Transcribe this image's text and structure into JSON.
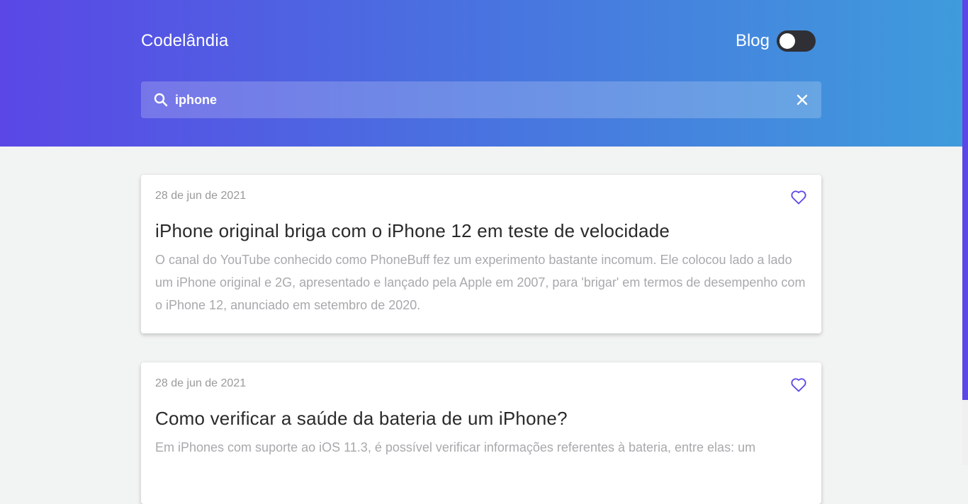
{
  "header": {
    "brand": "Codelândia",
    "blog_label": "Blog",
    "toggle_state": "off"
  },
  "search": {
    "value": "iphone",
    "icon": "search-icon",
    "clear_icon": "close-icon"
  },
  "posts": [
    {
      "date": "28 de jun de 2021",
      "title": "iPhone original briga com o iPhone 12 em teste de velocidade",
      "excerpt": "O canal do YouTube conhecido como PhoneBuff fez um experimento bastante incomum. Ele colocou lado a lado um iPhone original e 2G, apresentado e lançado pela Apple em 2007, para 'brigar' em termos de desempenho com o iPhone 12, anunciado em setembro de 2020.",
      "icon": "heart-icon"
    },
    {
      "date": "28 de jun de 2021",
      "title": "Como verificar a saúde da bateria de um iPhone?",
      "excerpt": "Em iPhones com suporte ao iOS 11.3, é possível verificar informações referentes à bateria, entre elas: um",
      "icon": "heart-icon"
    }
  ],
  "colors": {
    "accent": "#5a47e6",
    "gradient_end": "#3f9bdc",
    "background": "#f2f3f3"
  }
}
